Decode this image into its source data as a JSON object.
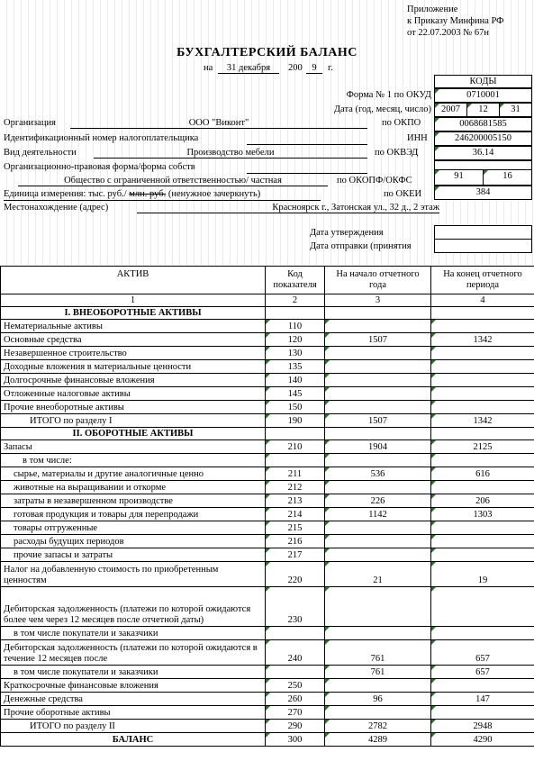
{
  "appendix": {
    "line1": "Приложение",
    "line2": "к Приказу Минфина РФ",
    "line3": "от 22.07.2003 № 67н"
  },
  "title": "БУХГАЛТЕРСКИЙ БАЛАНС",
  "date": {
    "na": "на",
    "day_month": "31 декабря",
    "year_prefix": "200",
    "year_suffix": "9",
    "g": "г."
  },
  "codes": {
    "header": "КОДЫ",
    "okud_label": "Форма № 1 по ОКУД",
    "okud": "0710001",
    "date_label": "Дата (год, месяц, число)",
    "year": "2007",
    "month": "12",
    "day": "31",
    "okpo_label": "по ОКПО",
    "okpo": "0068681585",
    "inn_label": "ИНН",
    "inn": "246200005150",
    "okved_label": "по ОКВЭД",
    "okved": "36.14",
    "okopf_label": "по ОКОПФ/ОКФС",
    "okopf": "91",
    "okfs": "16",
    "okei_label": "по ОКЕИ",
    "okei": "384"
  },
  "org": {
    "org_label": "Организация",
    "org_value": "ООО \"Виконт\"",
    "inn_label": "Идентификационный номер налогоплательщика",
    "activity_label": "Вид деятельности",
    "activity_value": "Производство мебели",
    "legal_label": "Организационно-правовая форма/форма собств",
    "legal_value": "Общество с ограниченной ответственностью/ частная",
    "unit_label_a": "Единица измерения: тыс. руб./",
    "unit_label_strike": "млн. руб.",
    "unit_label_b": "(ненужное зачеркнуть)",
    "address_label": "Местонахождение (адрес)",
    "address_value": "Красноярск г., Затонская ул., 32 д., 2 этаж",
    "approval_label": "Дата утверждения",
    "sent_label": "Дата отправки (принятия"
  },
  "table": {
    "headers": [
      "АКТИВ",
      "Код показателя",
      "На начало отчетного года",
      "На конец отчетного периода"
    ],
    "numbers": [
      "1",
      "2",
      "3",
      "4"
    ],
    "rows": [
      {
        "type": "section",
        "name": "I. ВНЕОБОРОТНЫЕ АКТИВЫ",
        "code": "",
        "start": "",
        "end": ""
      },
      {
        "type": "row",
        "name": "Нематериальные активы",
        "code": "110",
        "start": "",
        "end": ""
      },
      {
        "type": "row",
        "name": "Основные средства",
        "code": "120",
        "start": "1507",
        "end": "1342"
      },
      {
        "type": "row",
        "name": "Незавершенное строительство",
        "code": "130",
        "start": "",
        "end": ""
      },
      {
        "type": "row",
        "name": "Доходные вложения в материальные ценности",
        "code": "135",
        "start": "",
        "end": ""
      },
      {
        "type": "row",
        "name": "Долгосрочные финансовые вложения",
        "code": "140",
        "start": "",
        "end": ""
      },
      {
        "type": "row",
        "name": "Отложенные налоговые активы",
        "code": "145",
        "start": "",
        "end": ""
      },
      {
        "type": "row",
        "name": "Прочие внеоборотные активы",
        "code": "150",
        "start": "",
        "end": ""
      },
      {
        "type": "total",
        "name": "ИТОГО по разделу I",
        "code": "190",
        "start": "1507",
        "end": "1342"
      },
      {
        "type": "section",
        "name": "II. ОБОРОТНЫЕ АКТИВЫ",
        "code": "",
        "start": "",
        "end": ""
      },
      {
        "type": "row",
        "name": "Запасы",
        "code": "210",
        "start": "1904",
        "end": "2125"
      },
      {
        "type": "sub",
        "name": "в том числе:",
        "code": "",
        "start": "",
        "end": ""
      },
      {
        "type": "sub",
        "name": "сырье, материалы и другие аналогичные ценно",
        "code": "211",
        "start": "536",
        "end": "616"
      },
      {
        "type": "sub",
        "name": "животные на выращивании и откорме",
        "code": "212",
        "start": "",
        "end": ""
      },
      {
        "type": "sub",
        "name": "затраты в незавершенном производстве",
        "code": "213",
        "start": "226",
        "end": "206"
      },
      {
        "type": "sub",
        "name": "готовая продукция и товары для перепродажи",
        "code": "214",
        "start": "1142",
        "end": "1303"
      },
      {
        "type": "sub",
        "name": "товары отгруженные",
        "code": "215",
        "start": "",
        "end": ""
      },
      {
        "type": "sub",
        "name": "расходы будущих периодов",
        "code": "216",
        "start": "",
        "end": ""
      },
      {
        "type": "sub",
        "name": "прочие запасы и затраты",
        "code": "217",
        "start": "",
        "end": ""
      },
      {
        "type": "wrap2",
        "name": "Налог на добавленную стоимость по приобретенным ценностям",
        "code": "220",
        "start": "21",
        "end": "19"
      },
      {
        "type": "wrap3",
        "name": "Дебиторская задолженность (платежи по которой ожидаются более чем через 12 месяцев после отчетной даты)",
        "code": "230",
        "start": "",
        "end": ""
      },
      {
        "type": "sub",
        "name": "в том числе покупатели и заказчики",
        "code": "",
        "start": "",
        "end": ""
      },
      {
        "type": "wrap2",
        "name": "Дебиторская задолженность (платежи по которой ожидаются в течение 12 месяцев после",
        "code": "240",
        "start": "761",
        "end": "657"
      },
      {
        "type": "sub",
        "name": "в том числе покупатели и заказчики",
        "code": "",
        "start": "761",
        "end": "657"
      },
      {
        "type": "row",
        "name": "Краткосрочные финансовые вложения",
        "code": "250",
        "start": "",
        "end": ""
      },
      {
        "type": "row",
        "name": "Денежные средства",
        "code": "260",
        "start": "96",
        "end": "147"
      },
      {
        "type": "row",
        "name": "Прочие оборотные активы",
        "code": "270",
        "start": "",
        "end": ""
      },
      {
        "type": "total",
        "name": "ИТОГО по разделу II",
        "code": "290",
        "start": "2782",
        "end": "2948"
      },
      {
        "type": "grand",
        "name": "БАЛАНС",
        "code": "300",
        "start": "4289",
        "end": "4290"
      }
    ]
  }
}
